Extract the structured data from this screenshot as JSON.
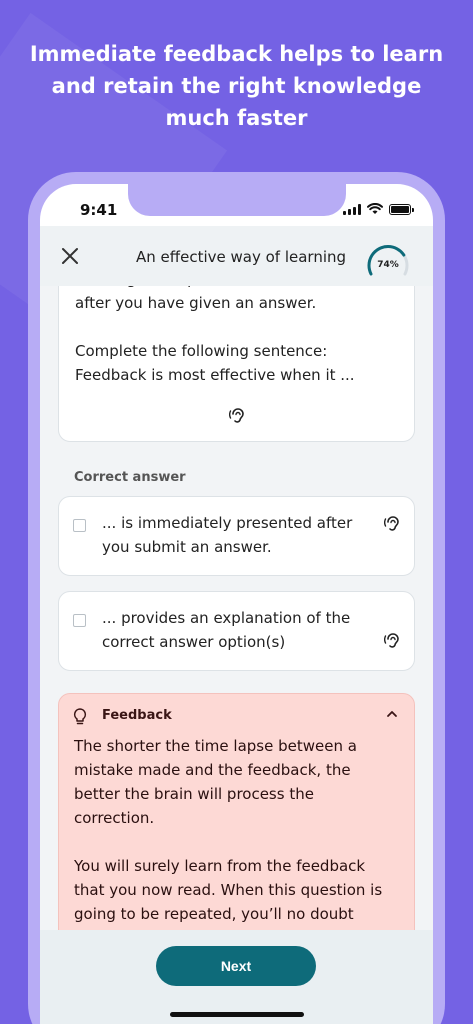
{
  "headline": "Immediate feedback helps to learn\nand retain the right knowledge\nmuch faster",
  "status": {
    "time": "9:41"
  },
  "header": {
    "title": "An effective way of learning",
    "progress_label": "74%",
    "progress": 0.74
  },
  "question": {
    "text": "learning is the presentation of feedback,\nafter you have given an answer.\n\nComplete the following sentence:\nFeedback is most effective when it ..."
  },
  "section_label": "Correct answer",
  "options": [
    {
      "text": "... is immediately presented after you submit an answer."
    },
    {
      "text": "... provides an explanation of the correct answer option(s)"
    }
  ],
  "feedback": {
    "title": "Feedback",
    "text": "The shorter the time lapse between a\nmistake made and the feedback, the\nbetter the brain will process the\ncorrection.\n\nYou will surely learn from the feedback\nthat you now read. When this question is\ngoing to be repeated, you’ll no doubt"
  },
  "footer": {
    "next_label": "Next"
  },
  "colors": {
    "background": "#7462e4",
    "accent": "#0e6b7a",
    "feedback_bg": "#fdd9d5"
  }
}
